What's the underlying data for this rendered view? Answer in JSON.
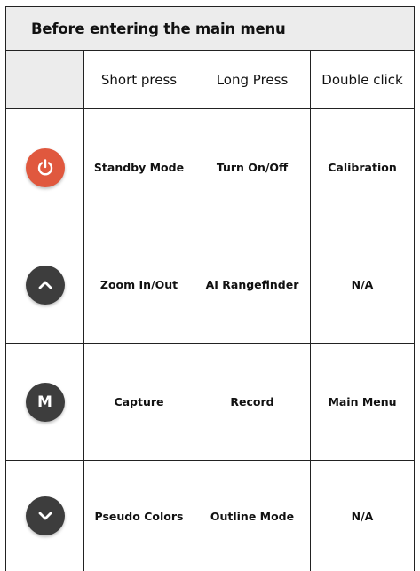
{
  "title": "Before entering the main menu",
  "columns": [
    "",
    "Short press",
    "Long Press",
    "Double click"
  ],
  "rows": [
    {
      "icon": "power-icon",
      "short": "Standby Mode",
      "long": "Turn On/Off",
      "double": "Calibration"
    },
    {
      "icon": "chevron-up-icon",
      "short": "Zoom In/Out",
      "long": "AI Rangefinder",
      "double": "N/A"
    },
    {
      "icon": "m-button-icon",
      "icon_label": "M",
      "short": "Capture",
      "long": "Record",
      "double": "Main Menu"
    },
    {
      "icon": "chevron-down-icon",
      "short": "Pseudo Colors",
      "long": "Outline Mode",
      "double": "N/A"
    }
  ],
  "colors": {
    "power_button": "#e0583e",
    "dark_button": "#3d3d3d",
    "header_bg": "#ececec"
  }
}
